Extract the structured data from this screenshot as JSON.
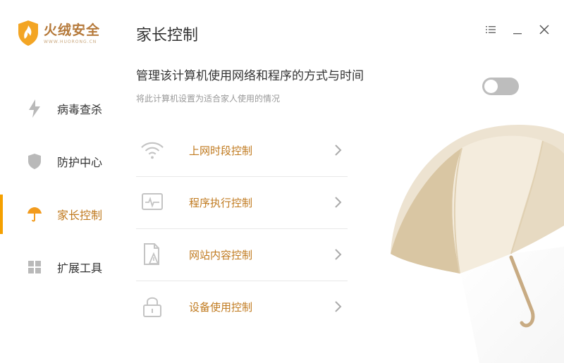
{
  "app": {
    "name": "火绒安全",
    "url": "WWW.HUORONG.CN",
    "brand_color": "#c07a1f",
    "accent_color": "#f5a000"
  },
  "sidebar": {
    "items": [
      {
        "label": "病毒查杀",
        "icon": "lightning-icon",
        "active": false
      },
      {
        "label": "防护中心",
        "icon": "shield-icon",
        "active": false
      },
      {
        "label": "家长控制",
        "icon": "umbrella-icon",
        "active": true
      },
      {
        "label": "扩展工具",
        "icon": "grid-icon",
        "active": false
      }
    ]
  },
  "window": {
    "controls": [
      "menu-icon",
      "minimize-icon",
      "close-icon"
    ]
  },
  "page": {
    "title": "家长控制",
    "heading": "管理该计算机使用网络和程序的方式与时间",
    "subheading": "将此计算机设置为适合家人使用的情况",
    "toggle_state": "off"
  },
  "controls": [
    {
      "label": "上网时段控制",
      "icon": "wifi-icon"
    },
    {
      "label": "程序执行控制",
      "icon": "program-monitor-icon"
    },
    {
      "label": "网站内容控制",
      "icon": "web-document-icon"
    },
    {
      "label": "设备使用控制",
      "icon": "lock-icon"
    }
  ]
}
